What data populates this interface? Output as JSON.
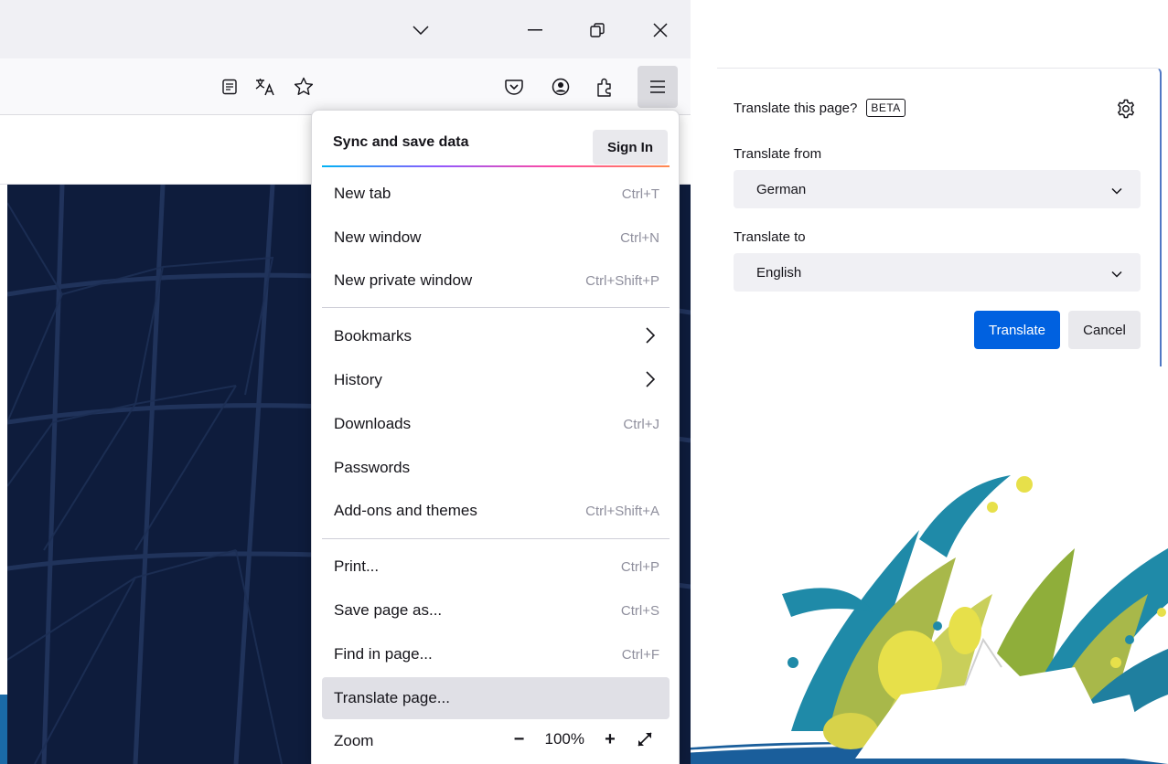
{
  "colors": {
    "accent_blue": "#0061e0",
    "menu_highlight": "#e0e0e6",
    "dark_page": "#0d1a36"
  },
  "window_controls": {
    "tab_list_icon": "chevron-down-icon",
    "minimize_icon": "minimize-icon",
    "restore_icon": "restore-icon",
    "close_icon": "close-icon"
  },
  "toolbar": {
    "icons": [
      "reader-view-icon",
      "translate-icon",
      "bookmark-star-icon",
      "pocket-icon",
      "account-icon",
      "extensions-icon",
      "hamburger-menu-icon"
    ]
  },
  "app_menu": {
    "sync_label": "Sync and save data",
    "sign_in_label": "Sign In",
    "items": [
      {
        "label": "New tab",
        "shortcut": "Ctrl+T"
      },
      {
        "label": "New window",
        "shortcut": "Ctrl+N"
      },
      {
        "label": "New private window",
        "shortcut": "Ctrl+Shift+P"
      },
      {
        "label": "Bookmarks",
        "shortcut": ""
      },
      {
        "label": "History",
        "shortcut": ""
      },
      {
        "label": "Downloads",
        "shortcut": "Ctrl+J"
      },
      {
        "label": "Passwords",
        "shortcut": ""
      },
      {
        "label": "Add-ons and themes",
        "shortcut": "Ctrl+Shift+A"
      },
      {
        "label": "Print...",
        "shortcut": "Ctrl+P"
      },
      {
        "label": "Save page as...",
        "shortcut": "Ctrl+S"
      },
      {
        "label": "Find in page...",
        "shortcut": "Ctrl+F"
      },
      {
        "label": "Translate page...",
        "shortcut": ""
      }
    ],
    "zoom": {
      "label": "Zoom",
      "value": "100%",
      "minus": "−",
      "plus": "+"
    }
  },
  "translate_panel": {
    "title": "Translate this page?",
    "badge": "BETA",
    "from_label": "Translate from",
    "from_value": "German",
    "to_label": "Translate to",
    "to_value": "English",
    "translate_button": "Translate",
    "cancel_button": "Cancel"
  }
}
